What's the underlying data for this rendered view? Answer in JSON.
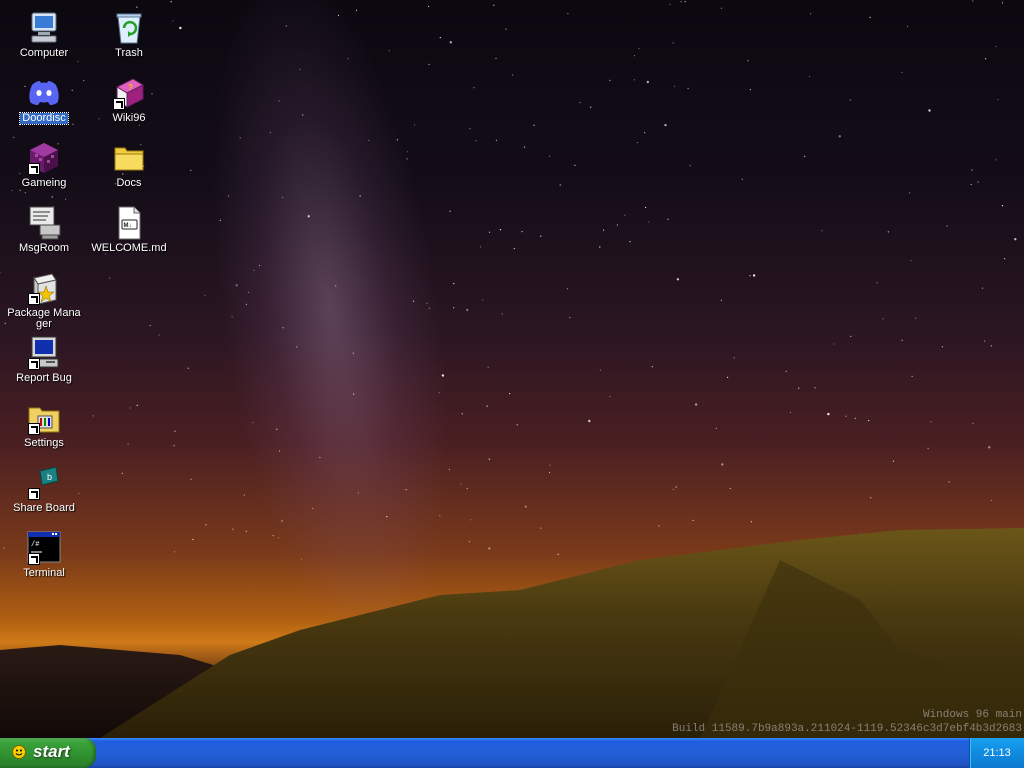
{
  "desktop": {
    "icons": [
      {
        "label": "Computer",
        "icon": "computer-icon"
      },
      {
        "label": "Trash",
        "icon": "recycle-bin-icon"
      },
      {
        "label": "Doordisc",
        "icon": "discord-icon"
      },
      {
        "label": "Wiki96",
        "icon": "book-icon"
      },
      {
        "label": "Gameing",
        "icon": "game-cube-icon"
      },
      {
        "label": "Docs",
        "icon": "folder-icon"
      },
      {
        "label": "MsgRoom",
        "icon": "chat-computer-icon"
      },
      {
        "label": "WELCOME.md",
        "icon": "markdown-file-icon"
      },
      {
        "label": "Package Manager",
        "icon": "package-icon"
      },
      {
        "label": "Report Bug",
        "icon": "report-computer-icon"
      },
      {
        "label": "Settings",
        "icon": "settings-folder-icon"
      },
      {
        "label": "Share Board",
        "icon": "share-board-icon"
      },
      {
        "label": "Terminal",
        "icon": "terminal-icon"
      }
    ],
    "selected": "Doordisc"
  },
  "watermark": {
    "line1": "Windows 96 main",
    "line2": "Build 11589.7b9a893a.211024-1119.52346c3d7ebf4b3d2683"
  },
  "taskbar": {
    "start_label": "start",
    "clock": "21:13"
  },
  "colors": {
    "taskbar_blue": "#2460d8",
    "start_green": "#3aa33a",
    "tray_blue": "#0f8be0",
    "selection": "#316ac5"
  }
}
